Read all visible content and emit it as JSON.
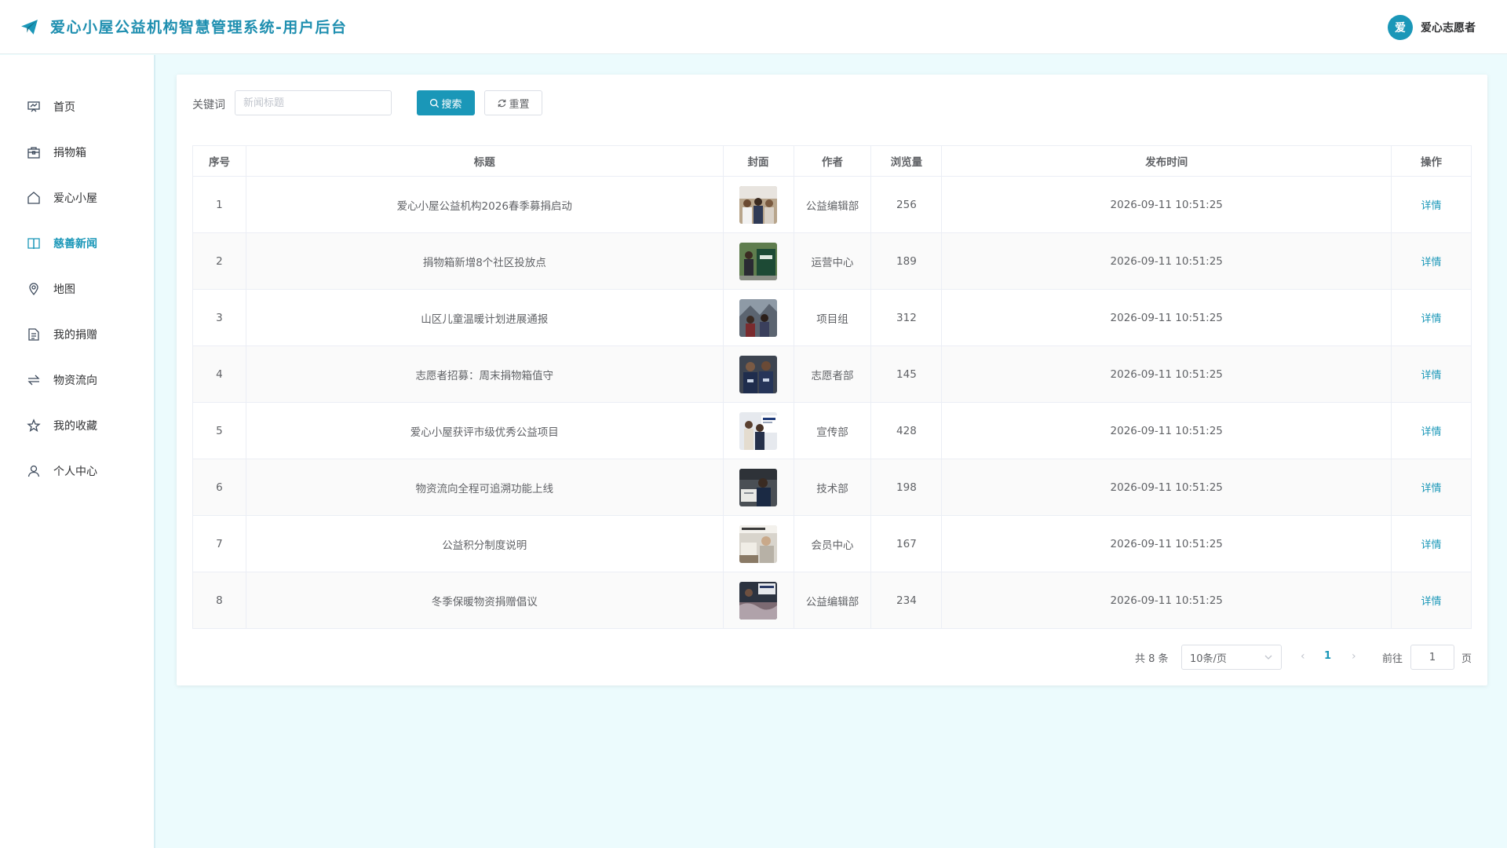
{
  "header": {
    "title": "爱心小屋公益机构智慧管理系统-用户后台",
    "user": {
      "avatar_text": "爱",
      "name": "爱心志愿者"
    }
  },
  "sidebar": {
    "items": [
      {
        "label": "首页",
        "icon": "dashboard-icon"
      },
      {
        "label": "捐物箱",
        "icon": "box-icon"
      },
      {
        "label": "爱心小屋",
        "icon": "house-icon"
      },
      {
        "label": "慈善新闻",
        "icon": "book-icon",
        "active": true
      },
      {
        "label": "地图",
        "icon": "location-icon"
      },
      {
        "label": "我的捐赠",
        "icon": "document-icon"
      },
      {
        "label": "物资流向",
        "icon": "switch-icon"
      },
      {
        "label": "我的收藏",
        "icon": "star-icon"
      },
      {
        "label": "个人中心",
        "icon": "user-icon"
      }
    ]
  },
  "search": {
    "label": "关键词",
    "placeholder": "新闻标题",
    "value": "",
    "search_label": "搜索",
    "reset_label": "重置"
  },
  "table": {
    "columns": [
      "序号",
      "标题",
      "封面",
      "作者",
      "浏览量",
      "发布时间",
      "操作"
    ],
    "action_label": "详情",
    "rows": [
      {
        "index": "1",
        "title": "爱心小屋公益机构2026春季募捐启动",
        "author": "公益编辑部",
        "views": "256",
        "time": "2026-09-11 10:51:25"
      },
      {
        "index": "2",
        "title": "捐物箱新增8个社区投放点",
        "author": "运营中心",
        "views": "189",
        "time": "2026-09-11 10:51:25"
      },
      {
        "index": "3",
        "title": "山区儿童温暖计划进展通报",
        "author": "项目组",
        "views": "312",
        "time": "2026-09-11 10:51:25"
      },
      {
        "index": "4",
        "title": "志愿者招募：周末捐物箱值守",
        "author": "志愿者部",
        "views": "145",
        "time": "2026-09-11 10:51:25"
      },
      {
        "index": "5",
        "title": "爱心小屋获评市级优秀公益项目",
        "author": "宣传部",
        "views": "428",
        "time": "2026-09-11 10:51:25"
      },
      {
        "index": "6",
        "title": "物资流向全程可追溯功能上线",
        "author": "技术部",
        "views": "198",
        "time": "2026-09-11 10:51:25"
      },
      {
        "index": "7",
        "title": "公益积分制度说明",
        "author": "会员中心",
        "views": "167",
        "time": "2026-09-11 10:51:25"
      },
      {
        "index": "8",
        "title": "冬季保暖物资捐赠倡议",
        "author": "公益编辑部",
        "views": "234",
        "time": "2026-09-11 10:51:25"
      }
    ]
  },
  "pagination": {
    "total_text": "共 8 条",
    "page_size": "10条/页",
    "current_page": "1",
    "goto_label": "前往",
    "goto_value": "1",
    "page_suffix": "页"
  },
  "colors": {
    "accent": "#1a97b8",
    "background": "#ecfbfd"
  }
}
